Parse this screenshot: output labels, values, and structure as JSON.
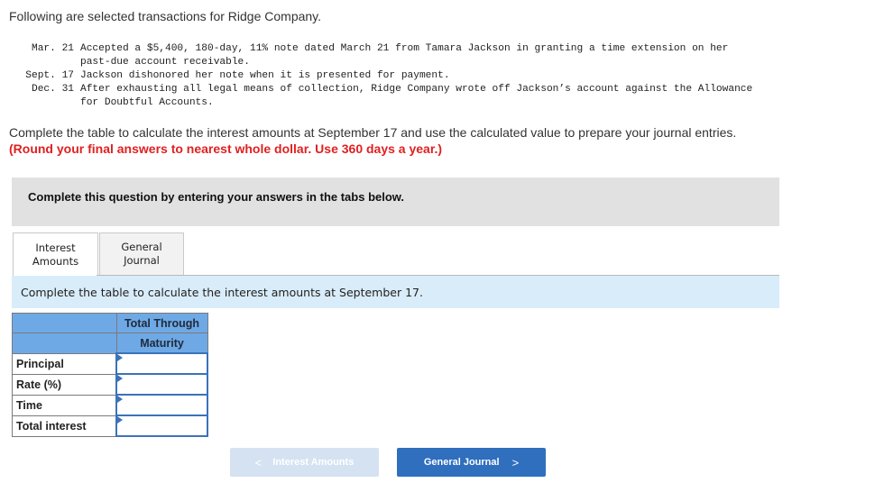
{
  "intro": "Following are selected transactions for Ridge Company.",
  "transactions": [
    {
      "date": "Mar. 21",
      "text": "Accepted a $5,400, 180-day, 11% note dated March 21 from Tamara Jackson in granting a time extension on her\npast-due account receivable."
    },
    {
      "date": "Sept. 17",
      "text": "Jackson dishonored her note when it is presented for payment."
    },
    {
      "date": "Dec. 31",
      "text": "After exhausting all legal means of collection, Ridge Company wrote off Jackson’s account against the Allowance\nfor Doubtful Accounts."
    }
  ],
  "instructions": "Complete the table to calculate the interest amounts at September 17 and use the calculated value to prepare your journal entries.",
  "instructions_red": "(Round your final answers to nearest whole dollar. Use 360 days a year.)",
  "banner": "Complete this question by entering your answers in the tabs below.",
  "tabs": [
    {
      "label_line1": "Interest",
      "label_line2": "Amounts",
      "active": true
    },
    {
      "label_line1": "General",
      "label_line2": "Journal",
      "active": false
    }
  ],
  "sub_instructions": "Complete the table to calculate the interest amounts at September 17.",
  "table": {
    "header_line1": "Total Through",
    "header_line2": "Maturity",
    "rows": [
      {
        "label": "Principal",
        "value": ""
      },
      {
        "label": "Rate (%)",
        "value": ""
      },
      {
        "label": "Time",
        "value": ""
      },
      {
        "label": "Total interest",
        "value": ""
      }
    ]
  },
  "nav": {
    "prev_label": "Interest Amounts",
    "prev_icon": "chevron-left-icon",
    "next_label": "General Journal",
    "next_icon": "chevron-right-icon"
  },
  "colors": {
    "accent": "#2f6fbe",
    "table_header": "#6ea9e6",
    "warning_text": "#e02020",
    "info_bg": "#d9ecf9"
  }
}
